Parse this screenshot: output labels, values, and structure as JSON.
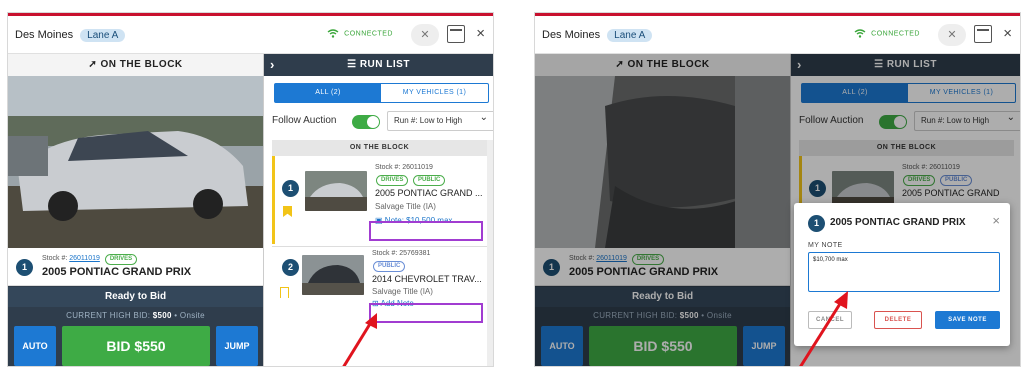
{
  "header": {
    "city": "Des Moines",
    "lane": "Lane A",
    "connection_status": "CONNECTED"
  },
  "on_the_block": {
    "heading": "ON THE BLOCK",
    "lot_number": "1",
    "stock_label": "Stock #:",
    "stock_number": "26011019",
    "badge": "DRIVES",
    "title": "2005 PONTIAC GRAND PRIX",
    "status": "Ready to Bid",
    "high_bid_label": "CURRENT HIGH BID:",
    "high_bid_value": "$500",
    "high_bid_source": "• Onsite",
    "auto_label": "AUTO",
    "bid_label": "BID $550",
    "jump_label": "JUMP"
  },
  "run_list": {
    "heading": "RUN LIST",
    "tab_all": "ALL (2)",
    "tab_mine": "MY VEHICLES (1)",
    "follow_label": "Follow Auction",
    "follow_on": true,
    "sort_value": "Run #: Low to High",
    "section_label": "ON THE BLOCK",
    "items": [
      {
        "lot": "1",
        "stock": "Stock #: 26011019",
        "pills": [
          "DRIVES",
          "PUBLIC"
        ],
        "title": "2005 PONTIAC GRAND ...",
        "subtitle": "Salvage Title (IA)",
        "note": "Note: $10,500 max"
      },
      {
        "lot": "2",
        "stock": "Stock #: 25769381",
        "pills": [
          "PUBLIC"
        ],
        "title": "2014 CHEVROLET TRAV...",
        "subtitle": "Salvage Title (IA)",
        "note": "Add Note"
      }
    ]
  },
  "right_screen": {
    "item_stock": "Stock #: 26011019",
    "item_pills": [
      "DRIVES",
      "PUBLIC"
    ],
    "item_title": "2005 PONTIAC GRAND"
  },
  "note_modal": {
    "lot": "1",
    "title": "2005 PONTIAC GRAND PRIX",
    "label": "MY NOTE",
    "value": "$10,700 max",
    "cancel": "CANCEL",
    "delete": "DELETE",
    "save": "SAVE NOTE"
  },
  "colors": {
    "brand_red": "#c8102e",
    "navy": "#2f3d4c",
    "accent_blue": "#1d79d3",
    "bid_green": "#3eab45",
    "highlight_purple": "#a13cd1",
    "arrow_red": "#e0141e"
  }
}
